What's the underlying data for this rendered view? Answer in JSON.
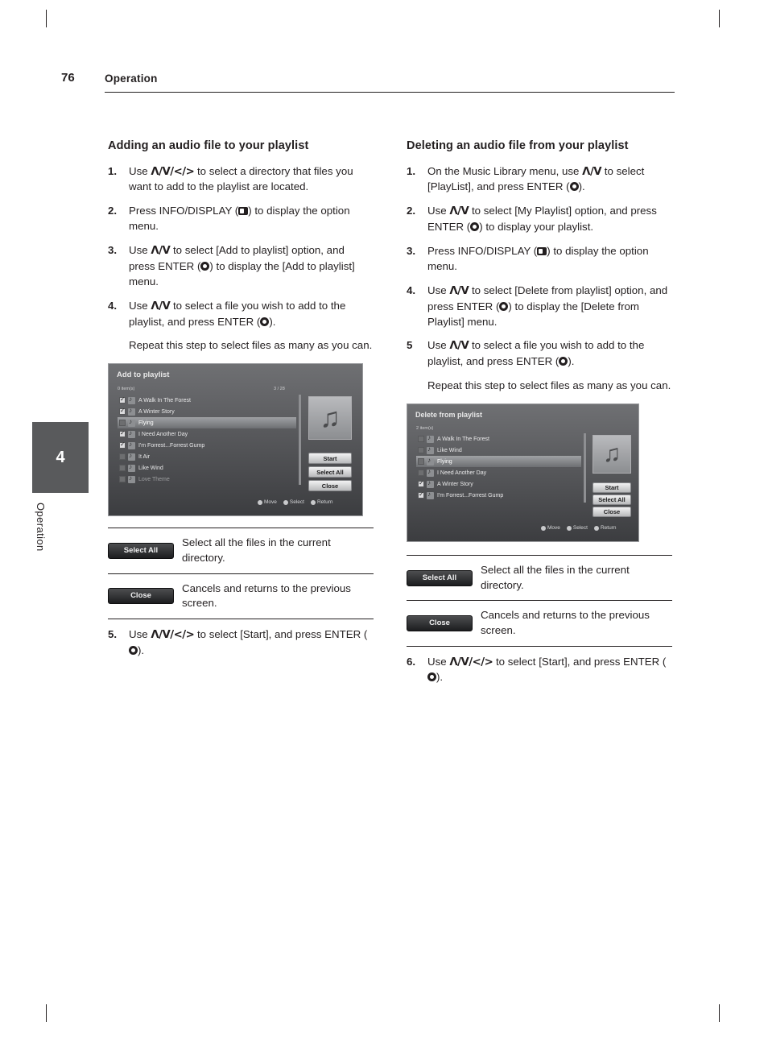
{
  "page": {
    "number": "76",
    "section": "Operation",
    "tab_number": "4",
    "tab_label": "Operation"
  },
  "left": {
    "heading": "Adding an audio file to your playlist",
    "steps": [
      {
        "n": "1.",
        "html": "Use Λ/V/</> to select a directory that files you want to add to the playlist are located."
      },
      {
        "n": "2.",
        "html": "Press INFO/DISPLAY ( ) to display the option menu."
      },
      {
        "n": "3.",
        "html": "Use Λ/V to select [Add to playlist] option, and press ENTER ( ) to display the [Add to playlist] menu."
      },
      {
        "n": "4.",
        "html": "Use Λ/V to select a file you wish to add to the playlist, and press ENTER ( )."
      },
      {
        "n": "",
        "html": "Repeat this step to select files as many as you can."
      },
      {
        "n": "5.",
        "html": "Use Λ/V/</> to select [Start], and press ENTER ( )."
      }
    ],
    "screenshot": {
      "title": "Add to playlist",
      "count_left": "0 item(s)",
      "count_right": "3 / 28",
      "items": [
        {
          "label": "A Walk In The Forest",
          "checked": true,
          "selected": false,
          "dim": false
        },
        {
          "label": "A Winter Story",
          "checked": true,
          "selected": false,
          "dim": false
        },
        {
          "label": "Flying",
          "checked": false,
          "selected": true,
          "dim": false
        },
        {
          "label": "I Need Another Day",
          "checked": true,
          "selected": false,
          "dim": false
        },
        {
          "label": "I'm Forrest...Forrest Gump",
          "checked": true,
          "selected": false,
          "dim": false
        },
        {
          "label": "It Air",
          "checked": false,
          "selected": false,
          "dim": false
        },
        {
          "label": "Like Wind",
          "checked": false,
          "selected": false,
          "dim": false
        },
        {
          "label": "Love Theme",
          "checked": false,
          "selected": false,
          "dim": true
        }
      ],
      "buttons": [
        "Start",
        "Select All",
        "Close"
      ],
      "legend": [
        "Move",
        "Select",
        "Return"
      ]
    },
    "button_table": [
      {
        "button": "Select All",
        "desc": "Select all the files in the current directory."
      },
      {
        "button": "Close",
        "desc": "Cancels and returns to the previous screen."
      }
    ]
  },
  "right": {
    "heading": "Deleting an audio file from your playlist",
    "steps": [
      {
        "n": "1.",
        "html": "On the Music Library menu, use Λ/V to select [PlayList], and press ENTER ( )."
      },
      {
        "n": "2.",
        "html": "Use Λ/V to select [My Playlist] option, and press ENTER ( ) to display your playlist."
      },
      {
        "n": "3.",
        "html": "Press INFO/DISPLAY ( ) to display the option menu."
      },
      {
        "n": "4.",
        "html": "Use Λ/V to select [Delete from playlist] option, and press ENTER ( ) to display the [Delete from Playlist] menu."
      },
      {
        "n": "5",
        "html": "Use Λ/V to select a file you wish to add to the playlist, and press ENTER ( )."
      },
      {
        "n": "",
        "html": "Repeat this step to select files as many as you can."
      },
      {
        "n": "6.",
        "html": "Use Λ/V/</> to select [Start], and press ENTER ( )."
      }
    ],
    "screenshot": {
      "title": "Delete from playlist",
      "count_left": "2 item(s)",
      "items": [
        {
          "label": "A Walk In The Forest",
          "checked": false,
          "selected": false,
          "dim": false
        },
        {
          "label": "Like Wind",
          "checked": false,
          "selected": false,
          "dim": false
        },
        {
          "label": "Flying",
          "checked": false,
          "selected": true,
          "dim": false
        },
        {
          "label": "I Need Another Day",
          "checked": false,
          "selected": false,
          "dim": false
        },
        {
          "label": "A Winter Story",
          "checked": true,
          "selected": false,
          "dim": false
        },
        {
          "label": "I'm Forrest...Forrest Gump",
          "checked": true,
          "selected": false,
          "dim": false
        }
      ],
      "buttons": [
        "Start",
        "Select All",
        "Close"
      ],
      "legend": [
        "Move",
        "Select",
        "Return"
      ]
    },
    "button_table": [
      {
        "button": "Select All",
        "desc": "Select all the files in the current directory."
      },
      {
        "button": "Close",
        "desc": "Cancels and returns to the previous screen."
      }
    ]
  }
}
